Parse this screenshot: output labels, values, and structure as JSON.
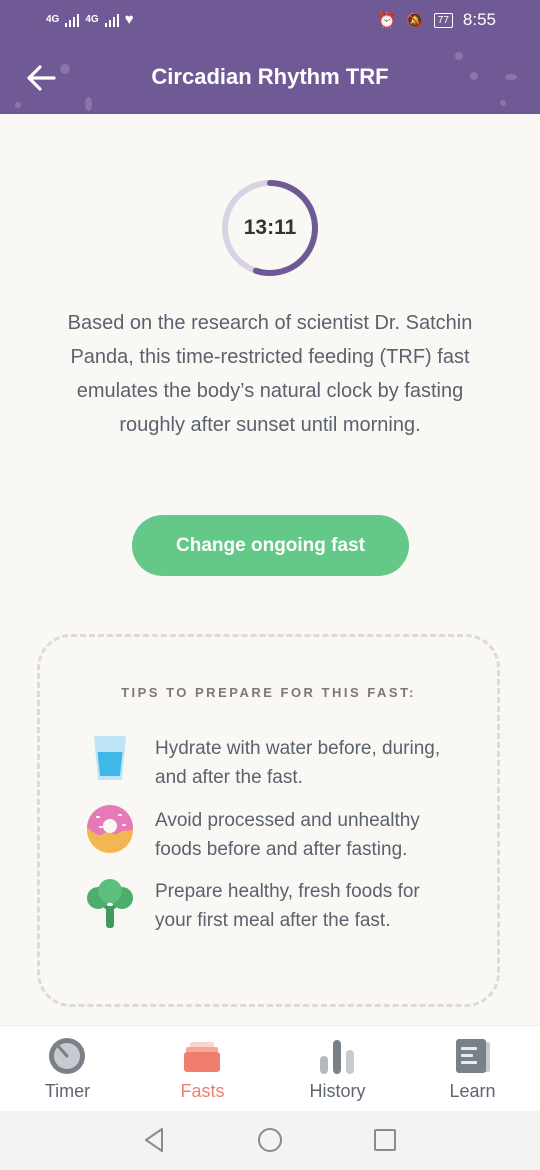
{
  "status_bar": {
    "network_1": "4G",
    "network_2": "4G",
    "battery": "77",
    "time": "8:55"
  },
  "header": {
    "title": "Circadian Rhythm TRF",
    "back_icon": "arrow-left-icon"
  },
  "timer": {
    "value": "13:11",
    "progress": 0.55
  },
  "description": "Based on the research of scientist Dr. Satchin Panda, this time-restricted feeding (TRF) fast emulates the body’s natural clock by fasting roughly after sunset until morning.",
  "change_button_label": "Change ongoing fast",
  "tips": {
    "heading": "TIPS TO PREPARE FOR THIS FAST:",
    "items": [
      {
        "icon": "water-glass-icon",
        "text": "Hydrate with water before, during, and after the fast."
      },
      {
        "icon": "donut-icon",
        "text": "Avoid processed and unhealthy foods before and after fasting."
      },
      {
        "icon": "broccoli-icon",
        "text": "Prepare healthy, fresh foods for your first meal after the fast."
      }
    ]
  },
  "nav": {
    "items": [
      {
        "label": "Timer",
        "icon": "timer-icon"
      },
      {
        "label": "Fasts",
        "icon": "fasts-icon",
        "active": true
      },
      {
        "label": "History",
        "icon": "history-chart-icon"
      },
      {
        "label": "Learn",
        "icon": "learn-book-icon"
      }
    ]
  },
  "colors": {
    "header": "#6f5a96",
    "button": "#64c888",
    "active_nav": "#f07e6e",
    "ring_progress": "#6f5a96",
    "ring_track": "#d8d3e3"
  }
}
